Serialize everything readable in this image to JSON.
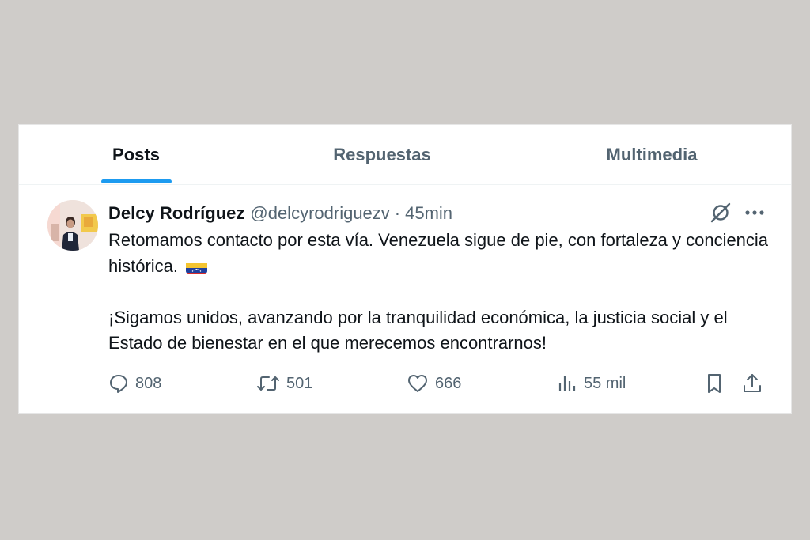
{
  "tabs": [
    {
      "label": "Posts",
      "active": true
    },
    {
      "label": "Respuestas",
      "active": false
    },
    {
      "label": "Multimedia",
      "active": false
    }
  ],
  "tweet": {
    "display_name": "Delcy Rodríguez",
    "handle": "@delcyrodriguezv",
    "separator": "·",
    "time": "45min",
    "paragraph1": "Retomamos contacto por esta vía. Venezuela sigue de pie, con fortaleza y conciencia histórica.",
    "paragraph2": "¡Sigamos unidos, avanzando por la tranquilidad económica, la justicia social y el Estado de bienestar en el que merecemos encontrarnos!",
    "flag_icon": "venezuela-flag-icon"
  },
  "actions": {
    "replies": "808",
    "reposts": "501",
    "likes": "666",
    "views": "55 mil"
  },
  "colors": {
    "accent": "#1d9bf0",
    "text_primary": "#0f1419",
    "text_secondary": "#536471",
    "backdrop": "#cfccc9"
  },
  "icons": [
    "grok-icon",
    "more-icon",
    "reply-icon",
    "retweet-icon",
    "like-icon",
    "views-icon",
    "bookmark-icon",
    "share-icon"
  ]
}
